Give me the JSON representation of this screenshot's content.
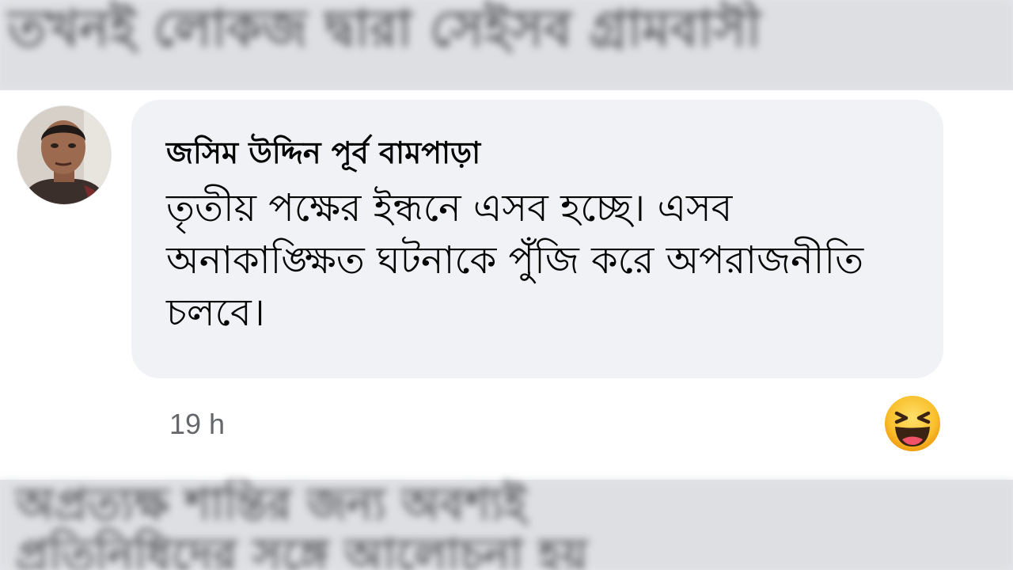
{
  "background": {
    "top_text_1": "তখনই লোকজ দ্বারা সেইসব গ্রামবাসী",
    "top_text_2": "",
    "bottom_text_1": "অপ্রত্যক্ষ শান্তির জন্য অবশ্যই",
    "bottom_text_2": "প্রতিনিধিদের সঙ্গে আলোচনা হয়"
  },
  "comment": {
    "author": "জসিম উদ্দিন পূর্ব বামপাড়া",
    "text": "তৃতীয় পক্ষের ইন্ধনে এসব হচ্ছে। এসব অনাকাঙ্ক্ষিত ঘটনাকে পুঁজি করে অপরাজনীতি চলবে।",
    "timestamp": "19 h",
    "reaction_icon": "haha-reaction-icon"
  },
  "colors": {
    "bubble": "#f0f2f5",
    "timestamp": "#65676b",
    "reaction": "#f7b125"
  }
}
